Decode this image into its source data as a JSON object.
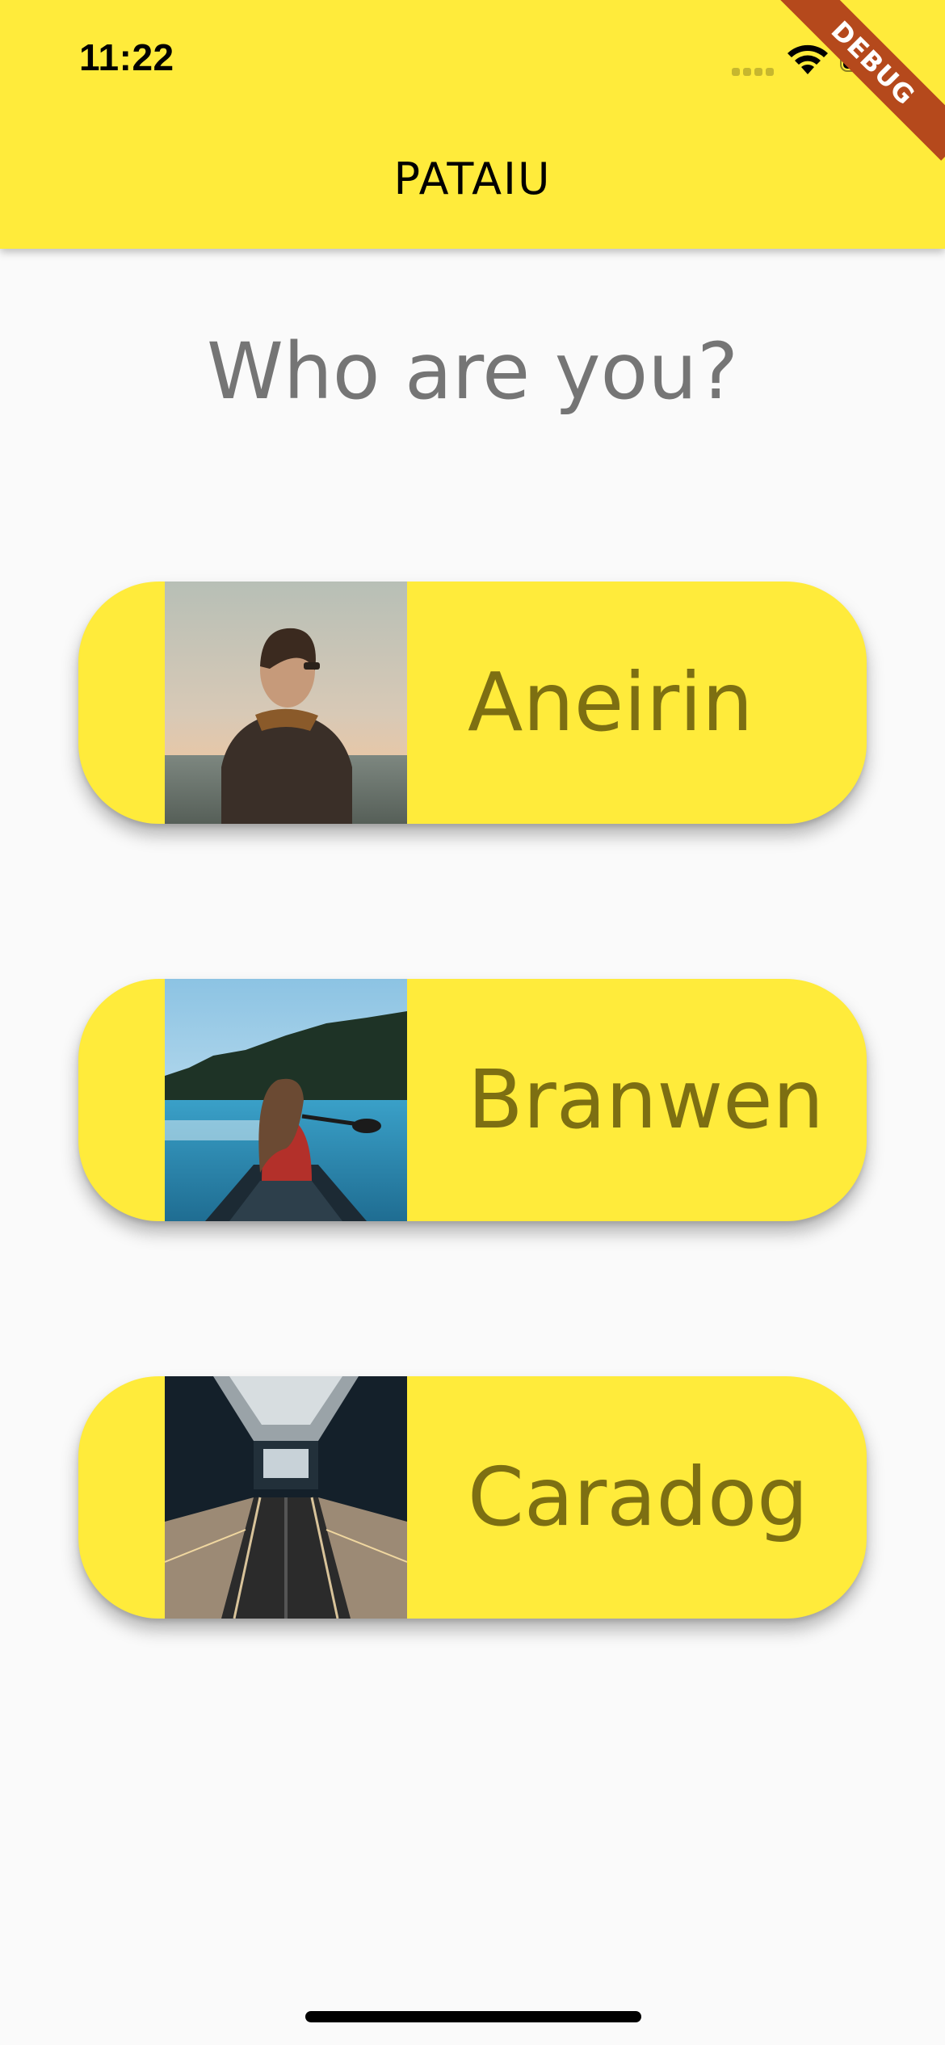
{
  "status_bar": {
    "time": "11:22",
    "icons": [
      "signal-icon",
      "wifi-icon",
      "battery-icon"
    ]
  },
  "app_bar": {
    "title": "PATAIU",
    "color": "#ffeb3b"
  },
  "debug_banner": {
    "label": "DEBUG",
    "color": "#b5491c"
  },
  "main": {
    "heading": "Who are you?",
    "people": [
      {
        "name": "Aneirin",
        "photo": "man-by-sea-photo"
      },
      {
        "name": "Branwen",
        "photo": "woman-in-canoe-photo"
      },
      {
        "name": "Caradog",
        "photo": "escalator-photo"
      }
    ]
  },
  "colors": {
    "accent": "#ffeb3b",
    "label_text": "#7d6f12",
    "heading_text": "#757575",
    "background": "#fafafa"
  }
}
